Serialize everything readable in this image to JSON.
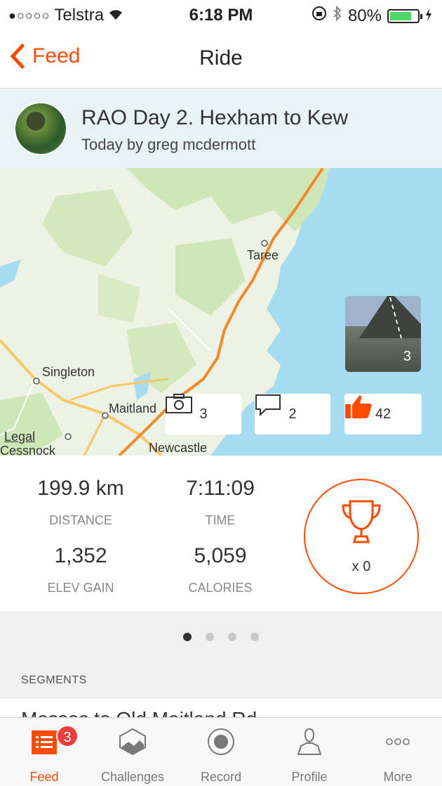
{
  "status_bar": {
    "carrier": "Telstra",
    "signal_dots": "●○○○○",
    "time": "6:18 PM",
    "battery": "80%",
    "battery_level": 0.8
  },
  "nav": {
    "back_label": "Feed",
    "title": "Ride"
  },
  "activity": {
    "title": "RAO Day 2. Hexham to Kew",
    "subtitle": "Today by greg mcdermott"
  },
  "map": {
    "labels": {
      "taree": "Taree",
      "singleton": "Singleton",
      "maitland": "Maitland",
      "newcastle": "Newcastle",
      "cessnock": "Cessnock",
      "legal": "Legal"
    },
    "photo_count": "3",
    "photos_count": "3",
    "comments_count": "2",
    "kudos_count": "42"
  },
  "stats": {
    "distance_value": "199.9 km",
    "distance_label": "DISTANCE",
    "time_value": "7:11:09",
    "time_label": "TIME",
    "elev_value": "1,352",
    "elev_label": "ELEV GAIN",
    "calories_value": "5,059",
    "calories_label": "CALORIES",
    "trophy_count": "x 0"
  },
  "segments": {
    "header": "SEGMENTS",
    "first_row": "Masses to Old Maitland Rd"
  },
  "tabs": [
    {
      "label": "Feed",
      "badge": "3"
    },
    {
      "label": "Challenges"
    },
    {
      "label": "Record"
    },
    {
      "label": "Profile"
    },
    {
      "label": "More"
    }
  ],
  "colors": {
    "accent": "#fc4c02",
    "badge": "#f23d3d",
    "water": "#a6dcef"
  }
}
